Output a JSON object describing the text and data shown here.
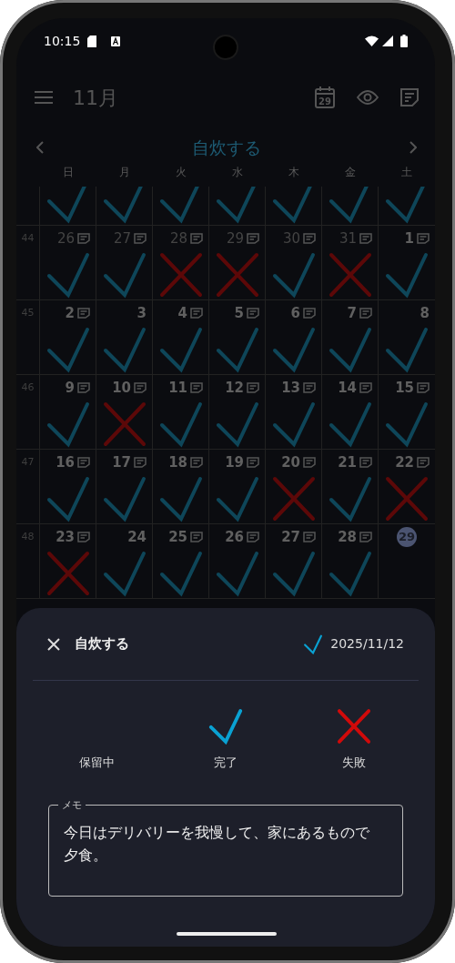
{
  "status_bar": {
    "time": "10:15"
  },
  "toolbar": {
    "title": "11月",
    "today_icon_label": "29"
  },
  "habit_header": {
    "title": "自炊する"
  },
  "weekdays": [
    "日",
    "月",
    "火",
    "水",
    "木",
    "金",
    "土"
  ],
  "weeks": [
    {
      "days": [
        {
          "kind": "done"
        },
        {
          "kind": "done"
        },
        {
          "kind": "done"
        },
        {
          "kind": "done"
        },
        {
          "kind": "done"
        },
        {
          "kind": "done"
        },
        {
          "kind": "done"
        }
      ]
    },
    {
      "week": "44",
      "days": [
        {
          "date": "26",
          "other_month": true,
          "note": true,
          "kind": "done"
        },
        {
          "date": "27",
          "other_month": true,
          "note": true,
          "kind": "done"
        },
        {
          "date": "28",
          "other_month": true,
          "note": true,
          "kind": "failed"
        },
        {
          "date": "29",
          "other_month": true,
          "note": true,
          "kind": "failed"
        },
        {
          "date": "30",
          "other_month": true,
          "note": true,
          "kind": "done"
        },
        {
          "date": "31",
          "other_month": true,
          "note": true,
          "kind": "failed"
        },
        {
          "date": "1",
          "note": true,
          "kind": "done"
        }
      ]
    },
    {
      "week": "45",
      "days": [
        {
          "date": "2",
          "note": true,
          "kind": "done"
        },
        {
          "date": "3",
          "kind": "done"
        },
        {
          "date": "4",
          "note": true,
          "kind": "done"
        },
        {
          "date": "5",
          "note": true,
          "kind": "done"
        },
        {
          "date": "6",
          "note": true,
          "kind": "done"
        },
        {
          "date": "7",
          "note": true,
          "kind": "done"
        },
        {
          "date": "8",
          "kind": "done"
        }
      ]
    },
    {
      "week": "46",
      "days": [
        {
          "date": "9",
          "note": true,
          "kind": "done"
        },
        {
          "date": "10",
          "note": true,
          "kind": "failed"
        },
        {
          "date": "11",
          "note": true,
          "kind": "done"
        },
        {
          "date": "12",
          "note": true,
          "kind": "done"
        },
        {
          "date": "13",
          "note": true,
          "kind": "done"
        },
        {
          "date": "14",
          "note": true,
          "kind": "done"
        },
        {
          "date": "15",
          "note": true,
          "kind": "done"
        }
      ]
    },
    {
      "week": "47",
      "days": [
        {
          "date": "16",
          "note": true,
          "kind": "done"
        },
        {
          "date": "17",
          "note": true,
          "kind": "done"
        },
        {
          "date": "18",
          "note": true,
          "kind": "done"
        },
        {
          "date": "19",
          "note": true,
          "kind": "done"
        },
        {
          "date": "20",
          "note": true,
          "kind": "failed"
        },
        {
          "date": "21",
          "note": true,
          "kind": "done"
        },
        {
          "date": "22",
          "note": true,
          "kind": "failed"
        }
      ]
    },
    {
      "week": "48",
      "days": [
        {
          "date": "23",
          "note": true,
          "kind": "failed"
        },
        {
          "date": "24",
          "kind": "done"
        },
        {
          "date": "25",
          "note": true,
          "kind": "done"
        },
        {
          "date": "26",
          "note": true,
          "kind": "done"
        },
        {
          "date": "27",
          "note": true,
          "kind": "done"
        },
        {
          "date": "28",
          "note": true,
          "kind": "done"
        },
        {
          "date": "29",
          "today": true,
          "kind": "none"
        }
      ]
    }
  ],
  "sheet": {
    "title": "自炊する",
    "status": {
      "kind": "done"
    },
    "date": "2025/11/12",
    "options": [
      {
        "kind": "pending",
        "label": "保留中"
      },
      {
        "kind": "done",
        "label": "完了"
      },
      {
        "kind": "failed",
        "label": "失敗"
      }
    ],
    "memo": {
      "label": "メモ",
      "value": "今日はデリバリーを我慢して、家にあるもので夕食。"
    }
  }
}
